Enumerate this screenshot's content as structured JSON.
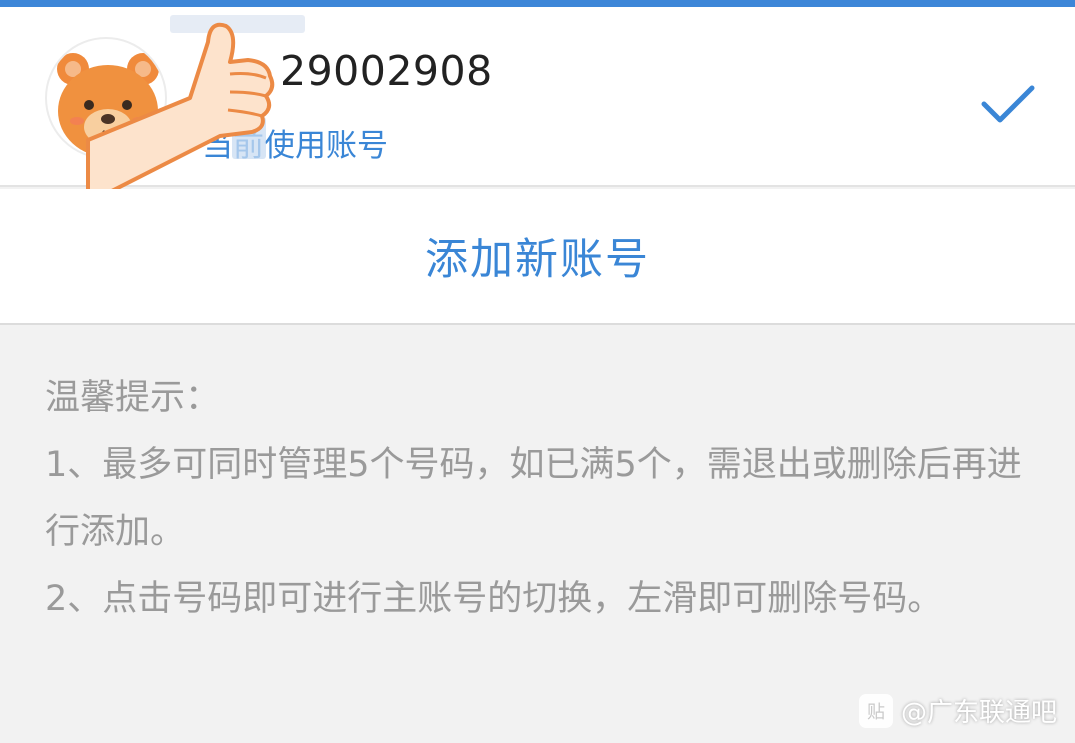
{
  "colors": {
    "accent": "#3a86d6",
    "top_bar": "#3d86d8",
    "background": "#f2f2f2",
    "tips_text": "#9a9a9a"
  },
  "account": {
    "number": "29002908",
    "status": "当前使用账号",
    "selected_icon": "check-icon",
    "avatar_icon": "bear-avatar-icon"
  },
  "add_account": {
    "label": "添加新账号"
  },
  "tips": {
    "title": "温馨提示：",
    "items": [
      "1、最多可同时管理5个号码，如已满5个，需退出或删除后再进行添加。",
      "2、点击号码即可进行主账号的切换，左滑即可删除号码。"
    ]
  },
  "watermark": {
    "logo": "贴",
    "text": "@广东联通吧"
  }
}
